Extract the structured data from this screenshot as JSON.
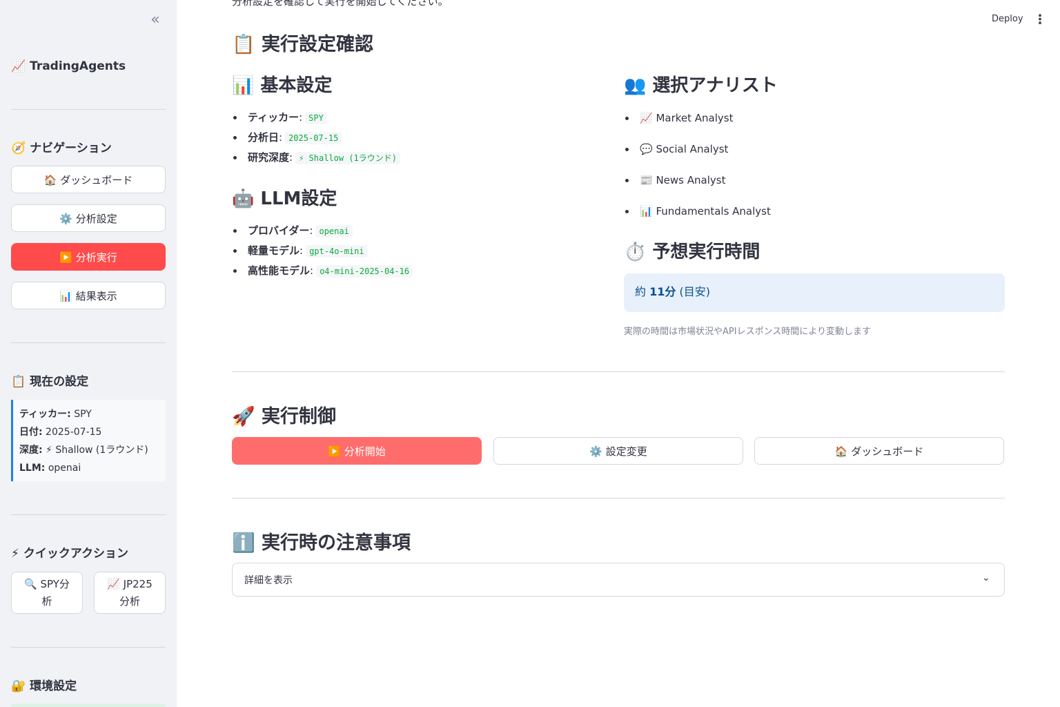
{
  "sidebar": {
    "collapse_icon": "«",
    "app_title": "📈 TradingAgents",
    "nav_title": "🧭 ナビゲーション",
    "nav_items": [
      {
        "label": "🏠 ダッシュボード"
      },
      {
        "label": "⚙️ 分析設定"
      },
      {
        "label": "▶️ 分析実行",
        "active": true
      },
      {
        "label": "📊 結果表示"
      }
    ],
    "current_title": "📋 現在の設定",
    "current": {
      "ticker_label": "ティッカー:",
      "ticker_value": " SPY",
      "date_label": "日付:",
      "date_value": " 2025-07-15",
      "depth_label": "深度:",
      "depth_value": " ⚡ Shallow (1ラウンド)",
      "llm_label": "LLM:",
      "llm_value": " openai"
    },
    "quick_title": "⚡ クイックアクション",
    "quick_spy_line1": "🔍 SPY分",
    "quick_spy_line2": "析",
    "quick_jp_line1": "📈 JP225",
    "quick_jp_line2": "分析",
    "env_title": "🔐 環境設定"
  },
  "header": {
    "deploy_label": "Deploy",
    "menu_icon": "⋮"
  },
  "main": {
    "intro_text": "分析設定を確認して実行を開始してください。",
    "confirm_title": "📋 実行設定確認",
    "basic_title": "📊 基本設定",
    "basic": [
      {
        "label": "ティッカー",
        "value": "SPY"
      },
      {
        "label": "分析日",
        "value": "2025-07-15"
      },
      {
        "label": "研究深度",
        "value": "⚡ Shallow (1ラウンド)"
      }
    ],
    "llm_title": "🤖 LLM設定",
    "llm": [
      {
        "label": "プロバイダー",
        "value": "openai"
      },
      {
        "label": "軽量モデル",
        "value": "gpt-4o-mini"
      },
      {
        "label": "高性能モデル",
        "value": "o4-mini-2025-04-16"
      }
    ],
    "analyst_title": "👥 選択アナリスト",
    "analysts": [
      "📈 Market Analyst",
      "💬 Social Analyst",
      "📰 News Analyst",
      "📊 Fundamentals Analyst"
    ],
    "time_title": "⏱️ 予想実行時間",
    "time_prefix": "約 ",
    "time_value": "11分",
    "time_suffix": " (目安)",
    "time_caption": "実際の時間は市場状況やAPIレスポンス時間により変動します",
    "control_title": "🚀 実行制御",
    "control_buttons": {
      "start": "▶️ 分析開始",
      "settings": "⚙️ 設定変更",
      "dashboard": "🏠 ダッシュボード"
    },
    "notes_title": "ℹ️ 実行時の注意事項",
    "expander_label": "詳細を表示",
    "expander_icon": "⌄"
  },
  "colors": {
    "primary": "#ff4b4b",
    "sidebar_bg": "#f0f2f6",
    "info_bg": "#e7f0fb",
    "code_green": "#09ab3b"
  }
}
